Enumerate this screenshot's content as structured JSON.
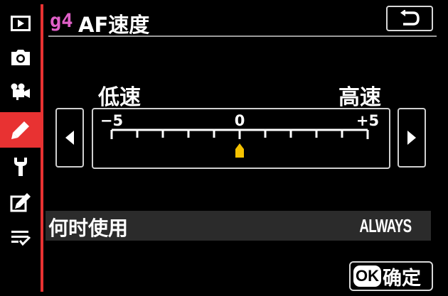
{
  "menu": {
    "code": "g4",
    "title": "AF速度"
  },
  "sidebar": {
    "items": [
      {
        "name": "playback-menu",
        "icon": "play-icon"
      },
      {
        "name": "photo-shooting-menu",
        "icon": "camera-icon"
      },
      {
        "name": "movie-shooting-menu",
        "icon": "movie-camera-icon"
      },
      {
        "name": "custom-settings-menu",
        "icon": "pencil-icon",
        "active": true
      },
      {
        "name": "setup-menu",
        "icon": "wrench-icon"
      },
      {
        "name": "retouch-menu",
        "icon": "retouch-icon"
      },
      {
        "name": "my-menu",
        "icon": "list-check-icon"
      }
    ],
    "accent_color": "#e83232"
  },
  "slider": {
    "label_low": "低速",
    "label_high": "高速",
    "min_label": "−5",
    "mid_label": "0",
    "max_label": "+5",
    "min": -5,
    "max": 5,
    "value": 0,
    "indicator_color": "#f5c200"
  },
  "option": {
    "label": "何时使用",
    "value": "ALWAYS"
  },
  "footer": {
    "ok_badge": "OK",
    "ok_label": "确定"
  },
  "colors": {
    "title_code": "#e060c8",
    "background": "#000000",
    "row_highlight": "#2b2b2b"
  }
}
